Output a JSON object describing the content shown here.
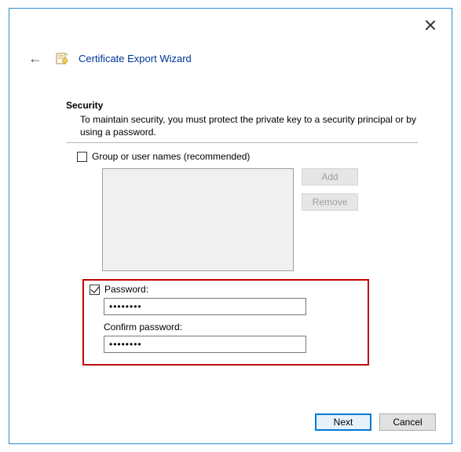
{
  "window": {
    "title": "Certificate Export Wizard"
  },
  "section": {
    "heading": "Security",
    "description": "To maintain security, you must protect the private key to a security principal or by using a password."
  },
  "group_users": {
    "checkbox_label": "Group or user names (recommended)",
    "checked": false,
    "add_label": "Add",
    "remove_label": "Remove"
  },
  "password": {
    "checkbox_label": "Password:",
    "checked": true,
    "value": "••••••••",
    "confirm_label": "Confirm password:",
    "confirm_value": "••••••••"
  },
  "footer": {
    "next_label": "Next",
    "cancel_label": "Cancel"
  }
}
